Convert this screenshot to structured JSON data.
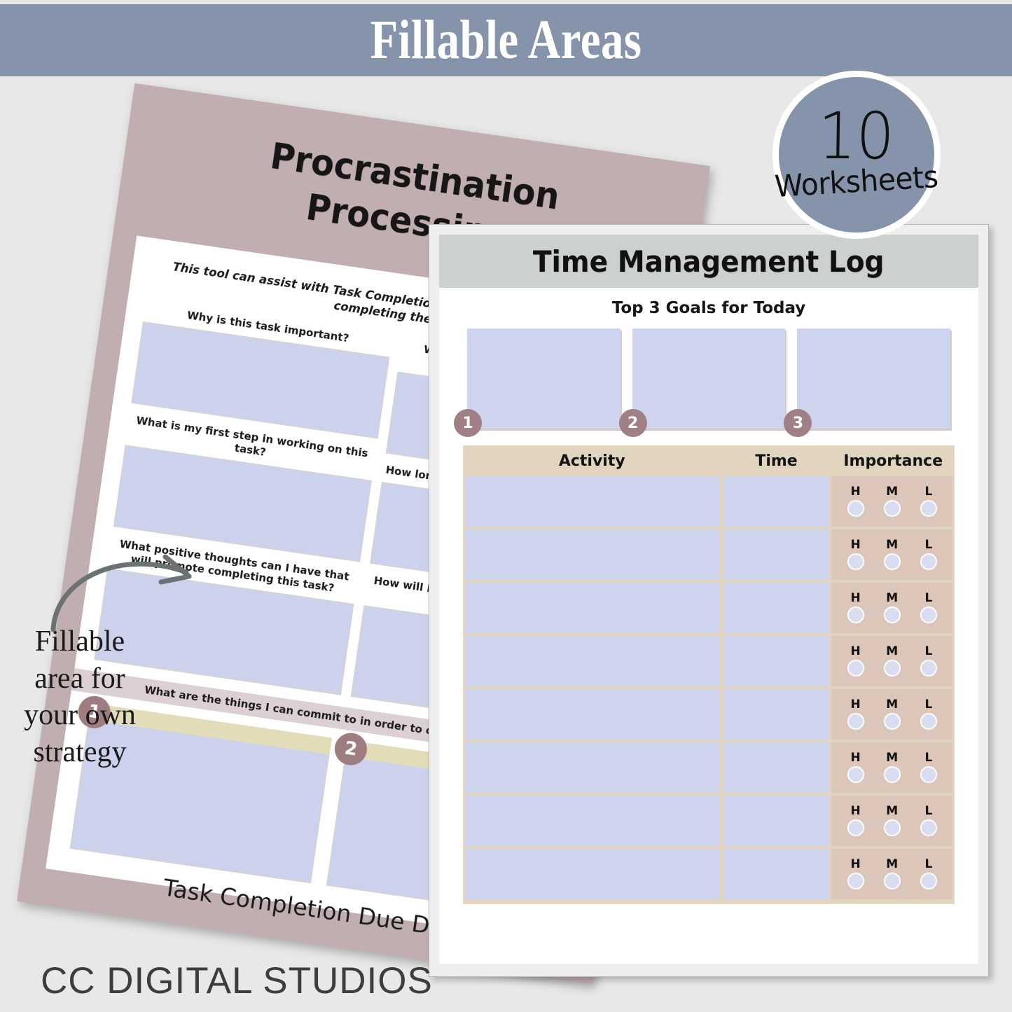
{
  "banner": {
    "title": "Fillable Areas",
    "bg_color": "#8694ab"
  },
  "badge": {
    "number": "10",
    "label": "Worksheets",
    "bg_color": "#8694ab",
    "ring_color": "#ffffff"
  },
  "annotation": {
    "text": "Fillable area for your own strategy",
    "arrow_icon": "curved-arrow-icon"
  },
  "footer": {
    "brand": "CC DIGITAL STUDIOS"
  },
  "worksheet_left": {
    "title": "Procrastination Processing",
    "header_color": "#c0aeb0",
    "subtitle": "This tool can assist with Task Completion by evaluating the outcome of completing the task.",
    "questions": [
      {
        "label": "Why is this task important?"
      },
      {
        "label": "What are the consequences of not completing this task?"
      },
      {
        "label": "What is my first step in working on this task?"
      },
      {
        "label": "How long will this task take to complete?"
      },
      {
        "label": "What positive thoughts can I have that will promote completing this task?"
      },
      {
        "label": "How will I reward myself for completing this task?"
      }
    ],
    "commit_label": "What are the things I can commit to in order to complete this task?",
    "commit_items": [
      {
        "number": "1"
      },
      {
        "number": "2"
      }
    ],
    "footer_label": "Task Completion Due Date",
    "field_fill_color": "#cdd2ec"
  },
  "worksheet_right": {
    "title": "Time Management Log",
    "header_color": "#ccd1d0",
    "goals_title": "Top 3 Goals for Today",
    "goals": [
      {
        "number": "1"
      },
      {
        "number": "2"
      },
      {
        "number": "3"
      }
    ],
    "table": {
      "headers": [
        "Activity",
        "Time",
        "Importance"
      ],
      "header_color": "#e2d5c0",
      "importance_options": [
        "H",
        "M",
        "L"
      ],
      "importance_color": "#dcc6ba",
      "field_fill_color": "#cfd4ee",
      "rows": [
        {
          "activity": "",
          "time": "",
          "importance": ""
        },
        {
          "activity": "",
          "time": "",
          "importance": ""
        },
        {
          "activity": "",
          "time": "",
          "importance": ""
        },
        {
          "activity": "",
          "time": "",
          "importance": ""
        },
        {
          "activity": "",
          "time": "",
          "importance": ""
        },
        {
          "activity": "",
          "time": "",
          "importance": ""
        },
        {
          "activity": "",
          "time": "",
          "importance": ""
        },
        {
          "activity": "",
          "time": "",
          "importance": ""
        }
      ]
    }
  }
}
